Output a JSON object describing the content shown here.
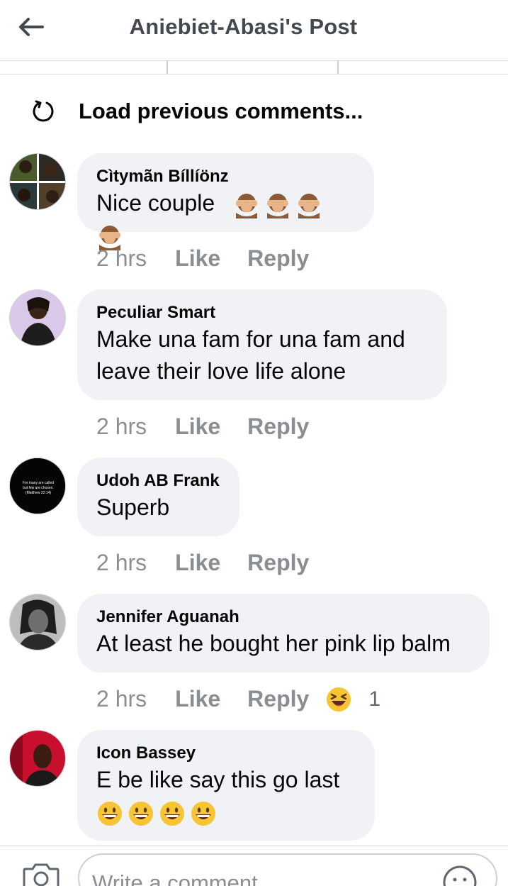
{
  "header": {
    "title": "Aniebiet-Abasi's Post",
    "back_icon": "arrow-left-icon"
  },
  "load_previous": {
    "label": "Load previous comments...",
    "icon": "refresh-icon"
  },
  "comments": [
    {
      "author": "Cìtymãn Bíllíönz",
      "text": "Nice couple",
      "emoji": "see-no-evil-monkey",
      "emoji_count": 4,
      "time": "2 hrs",
      "like": "Like",
      "reply": "Reply"
    },
    {
      "author": "Peculiar Smart",
      "text_lines": [
        "Make una fam for una fam and",
        "leave their love life alone"
      ],
      "time": "2 hrs",
      "like": "Like",
      "reply": "Reply"
    },
    {
      "author": "Udoh AB Frank",
      "text": "Superb",
      "avatar_text": [
        "For many are called",
        "but few are chosen.",
        "(Matthew 22:14)"
      ],
      "time": "2 hrs",
      "like": "Like",
      "reply": "Reply"
    },
    {
      "author": "Jennifer Aguanah",
      "text": "At least he bought her pink lip balm",
      "time": "2 hrs",
      "like": "Like",
      "reply": "Reply",
      "reaction": {
        "icon": "laughing-face",
        "count": "1"
      }
    },
    {
      "author": "Icon Bassey",
      "text": "E be like say this go last",
      "emoji": "grinning-face",
      "emoji_count": 4
    }
  ],
  "composer": {
    "placeholder": "Write a comment...",
    "camera_icon": "camera-icon",
    "emoji_icon": "smiley-icon"
  },
  "colors": {
    "bubble": "#f0f2f5",
    "meta_text": "#8a8d91",
    "divider": "#dadde1"
  }
}
